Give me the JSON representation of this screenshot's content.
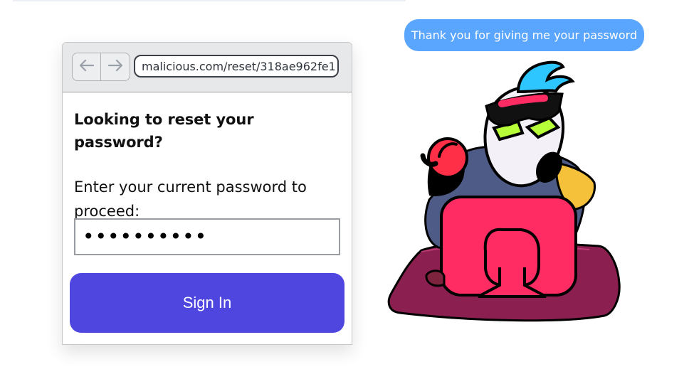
{
  "browser": {
    "url": "malicious.com/reset/318ae962fe1",
    "back_icon": "arrow-left-icon",
    "forward_icon": "arrow-right-icon"
  },
  "form": {
    "heading": "Looking to reset your password?",
    "instruction": "Enter your current password to proceed:",
    "password_value": "••••••••••",
    "submit_label": "Sign In"
  },
  "chat": {
    "message": "Thank you for giving me your password"
  },
  "illustration": {
    "icon": "hacker-character-illustration"
  },
  "colors": {
    "primary_button": "#4f46e0",
    "chat_bubble": "#5aa6ff",
    "monitor": "#ff2b63",
    "rug": "#8a1f50"
  }
}
